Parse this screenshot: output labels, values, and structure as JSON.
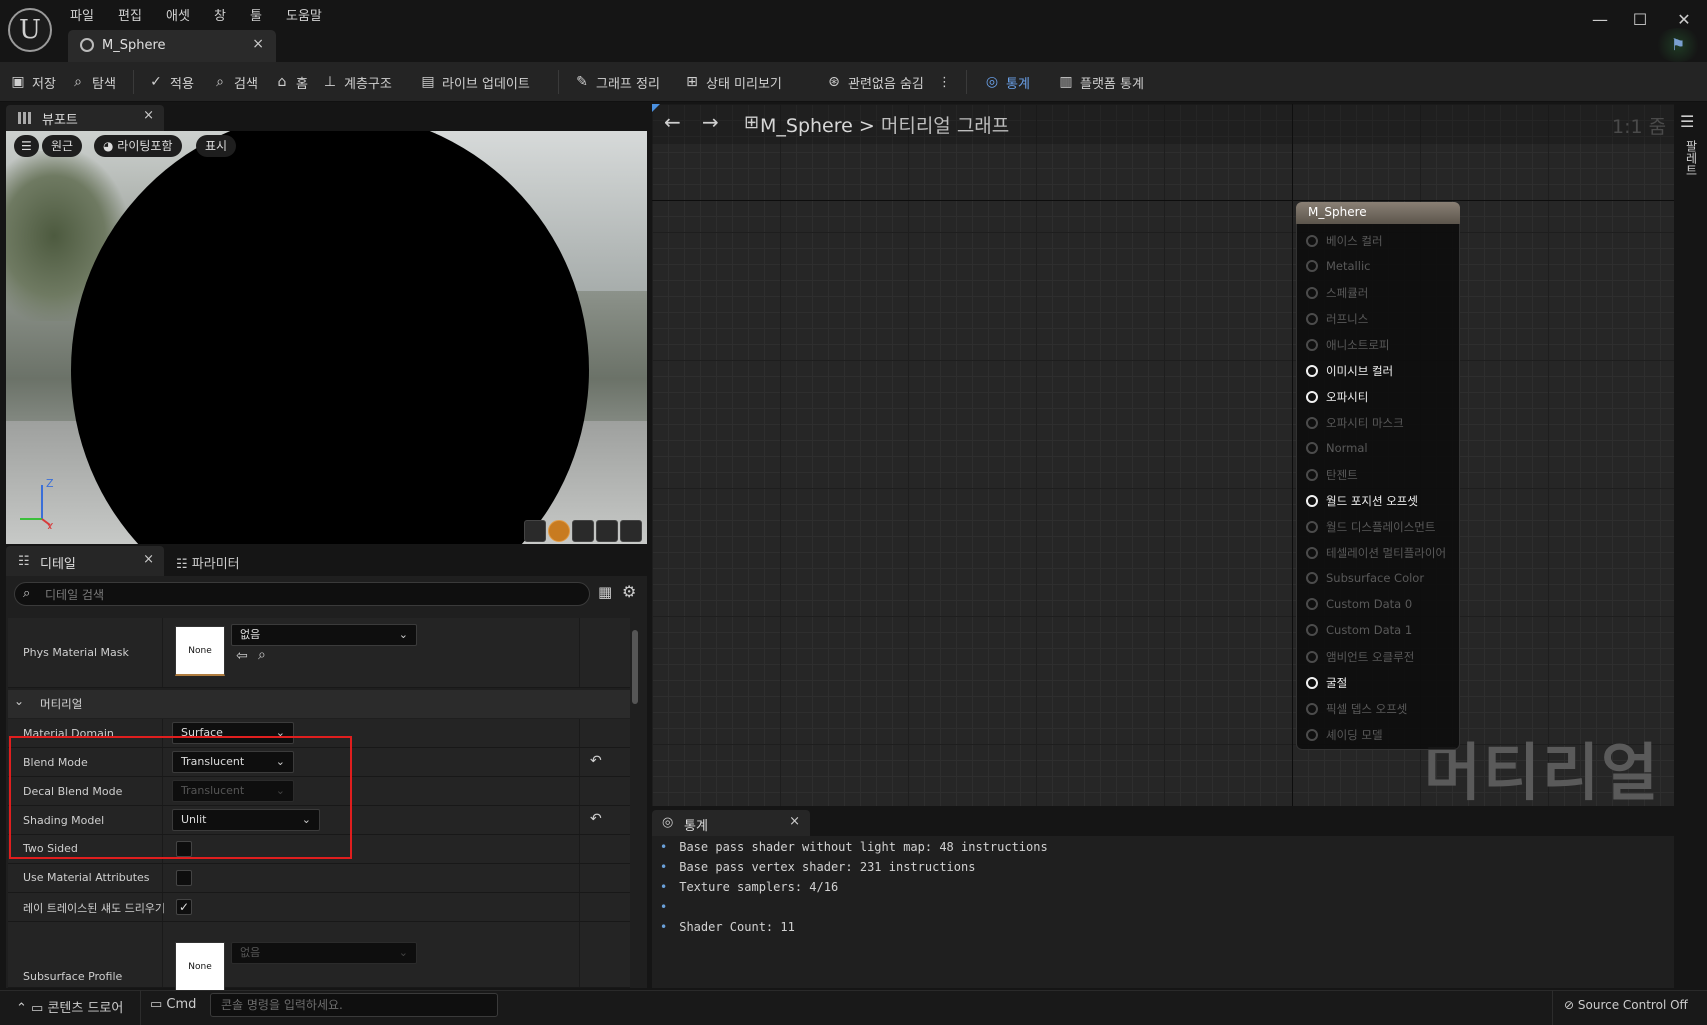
{
  "app": {
    "logo": "U",
    "menu": [
      "파일",
      "편집",
      "애셋",
      "창",
      "툴",
      "도움말"
    ],
    "document_tab": {
      "label": "M_Sphere",
      "close": "×",
      "icon": "material-icon"
    },
    "window_controls": {
      "minimize": "—",
      "maximize": "☐",
      "close": "✕"
    }
  },
  "toolbar": {
    "save": "저장",
    "browse": "탐색",
    "apply": "적용",
    "search": "검색",
    "home": "홈",
    "hierarchy": "계층구조",
    "live_update": "라이브 업데이트",
    "clean_graph": "그래프 정리",
    "preview_state": "상태 미리보기",
    "hide_unrelated": "관련없음 숨김",
    "more": "⋮",
    "stats": "통계",
    "platform_stats": "플랫폼 통계"
  },
  "viewport": {
    "tab_label": "뷰포트",
    "close": "×",
    "perspective": "원근",
    "lighting": "라이팅포함",
    "show": "표시",
    "axis_z": "Z",
    "axis_x": "X"
  },
  "details": {
    "tab_label": "디테일",
    "close": "×",
    "params_tab": "파라미터",
    "search_placeholder": "디테일 검색",
    "phys_material_mask": {
      "name": "Phys Material Mask",
      "thumb": "None",
      "value": "없음"
    },
    "section_material": "머티리얼",
    "material_domain": {
      "name": "Material Domain",
      "value": "Surface"
    },
    "blend_mode": {
      "name": "Blend Mode",
      "value": "Translucent"
    },
    "decal_blend_mode": {
      "name": "Decal Blend Mode",
      "value": "Translucent"
    },
    "shading_model": {
      "name": "Shading Model",
      "value": "Unlit"
    },
    "two_sided": {
      "name": "Two Sided",
      "checked": false
    },
    "use_material_attributes": {
      "name": "Use Material Attributes",
      "checked": false
    },
    "ray_traced_shadows": {
      "name": "레이 트레이스된 섀도 드리우기",
      "checked": true
    },
    "subsurface_profile": {
      "name": "Subsurface Profile",
      "thumb": "None",
      "value": "없음"
    }
  },
  "graph": {
    "breadcrumb_asset": "M_Sphere",
    "breadcrumb_sep": ">",
    "breadcrumb_graph": "머티리얼 그래프",
    "zoom": "1:1 줌",
    "watermark": "머티리얼",
    "node": {
      "title": "M_Sphere",
      "pins": [
        {
          "label": "베이스 컬러",
          "active": false
        },
        {
          "label": "Metallic",
          "active": false
        },
        {
          "label": "스페큘러",
          "active": false
        },
        {
          "label": "러프니스",
          "active": false
        },
        {
          "label": "애니소트로피",
          "active": false
        },
        {
          "label": "이미시브 컬러",
          "active": true
        },
        {
          "label": "오파시티",
          "active": true
        },
        {
          "label": "오파시티 마스크",
          "active": false
        },
        {
          "label": "Normal",
          "active": false
        },
        {
          "label": "탄젠트",
          "active": false
        },
        {
          "label": "월드 포지션 오프셋",
          "active": true
        },
        {
          "label": "월드 디스플레이스먼트",
          "active": false
        },
        {
          "label": "테셀레이션 멀티플라이어",
          "active": false
        },
        {
          "label": "Subsurface Color",
          "active": false
        },
        {
          "label": "Custom Data 0",
          "active": false
        },
        {
          "label": "Custom Data 1",
          "active": false
        },
        {
          "label": "앰비언트 오클루전",
          "active": false
        },
        {
          "label": "굴절",
          "active": true
        },
        {
          "label": "픽셀 뎁스 오프셋",
          "active": false
        },
        {
          "label": "셰이딩 모델",
          "active": false
        }
      ]
    }
  },
  "stats": {
    "tab_label": "통계",
    "close": "×",
    "lines": [
      "Base pass shader without light map: 48 instructions",
      "Base pass vertex shader: 231 instructions",
      "Texture samplers: 4/16",
      "",
      "Shader Count: 11"
    ]
  },
  "right_sidebar": {
    "palette": "팔레트"
  },
  "statusbar": {
    "content_drawer": "콘텐츠 드로어",
    "cmd": "Cmd",
    "cmd_placeholder": "콘솔 명령을 입력하세요.",
    "source_control": "Source Control Off"
  }
}
